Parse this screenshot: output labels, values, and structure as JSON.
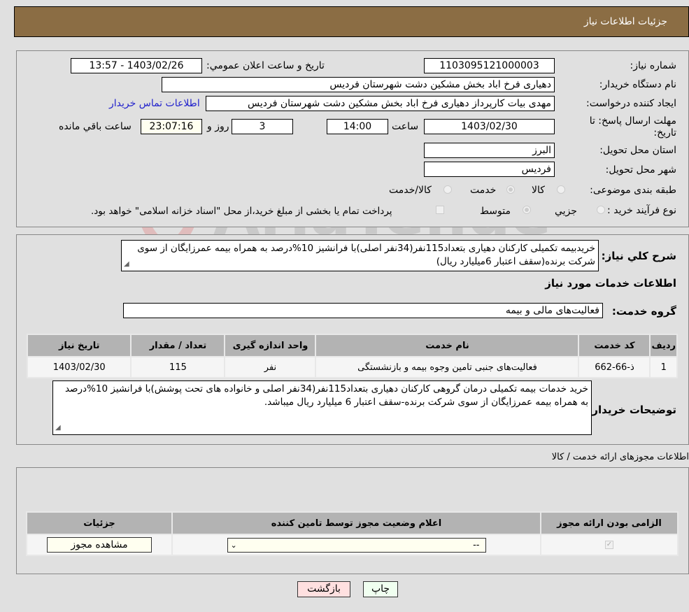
{
  "header": {
    "title": "جزئیات اطلاعات نیاز"
  },
  "form": {
    "need_number_label": "شماره نیاز:",
    "need_number": "1103095121000003",
    "announce_label": "تاریخ و ساعت اعلان عمومي:",
    "announce_value": "1403/02/26 - 13:57",
    "buyer_org_label": "نام دستگاه خریدار:",
    "buyer_org": "دهیاری فرخ اباد بخش مشکین دشت شهرستان فردیس",
    "requester_label": "ایجاد کننده درخواست:",
    "requester": "مهدی بیات کارپرداز دهیاری فرخ اباد بخش مشکین دشت شهرستان فردیس",
    "contact_link": "اطلاعات تماس خریدار",
    "deadline_label": "مهلت ارسال پاسخ: تا تاریخ:",
    "deadline_date": "1403/02/30",
    "time_label": "ساعت",
    "deadline_time": "14:00",
    "days_value": "3",
    "days_label": "روز و",
    "remaining_time": "23:07:16",
    "remaining_label": "ساعت باقي مانده",
    "province_label": "استان محل تحویل:",
    "province": "البرز",
    "city_label": "شهر محل تحویل:",
    "city": "فردیس",
    "category_label": "طبقه بندی موضوعی:",
    "category_options": [
      {
        "label": "کالا",
        "selected": false
      },
      {
        "label": "خدمت",
        "selected": true
      },
      {
        "label": "کالا/خدمت",
        "selected": false
      }
    ],
    "process_label": "نوع فرآیند خرید :",
    "process_options": [
      {
        "label": "جزيي",
        "selected": false
      },
      {
        "label": "متوسط",
        "selected": true
      }
    ],
    "treasury_checkbox_label": "پرداخت تمام یا بخشی از مبلغ خرید،از محل \"اسناد خزانه اسلامی\" خواهد بود.",
    "treasury_checked": false
  },
  "summary": {
    "label": "شرح کلي نیاز:",
    "text": "خریدبیمه تکمیلی کارکنان دهیاری بتعداد115نفر(34نفر اصلی)با فرانشیز 10%درصد به همراه بیمه عمرزایگان از سوی شرکت برنده(سقف اعتبار 6میلیارد ریال)"
  },
  "services": {
    "section_title": "اطلاعات خدمات مورد نیاز",
    "group_label": "گروه خدمت:",
    "group_value": "فعالیت‌های مالی و بیمه",
    "columns": [
      "ردیف",
      "کد خدمت",
      "نام خدمت",
      "واحد اندازه گیری",
      "تعداد / مقدار",
      "تاریخ نیاز"
    ],
    "rows": [
      [
        "1",
        "ذ-66-662",
        "فعالیت‌های جنبی تامین وجوه بیمه و بازنشستگی",
        "نفر",
        "115",
        "1403/02/30"
      ]
    ]
  },
  "buyer_notes": {
    "label": "توضیحات خریدار:",
    "text": "خرید خدمات بیمه تکمیلی درمان گروهی کارکنان دهیاری بتعداد115نفر(34نفر اصلی و خانواده های تحت پوشش)با فرانشیز 10%درصد به همراه بیمه عمرزایگان از سوی شرکت برنده-سقف اعتبار 6 میلیارد ریال میباشد."
  },
  "permits": {
    "section_title": "اطلاعات مجوزهای ارائه خدمت / کالا",
    "columns": [
      "الزامی بودن ارائه مجوز",
      "اعلام وضعیت مجوز توسط تامین کننده",
      "جزئیات"
    ],
    "row": {
      "required_checked": true,
      "status_value": "--",
      "details_button": "مشاهده مجوز"
    }
  },
  "footer": {
    "print_button": "چاپ",
    "back_button": "بازگشت"
  },
  "colors": {
    "header_bg": "#8b6d44",
    "print_bg": "#f0fff0",
    "back_bg": "#ffe0e0"
  }
}
